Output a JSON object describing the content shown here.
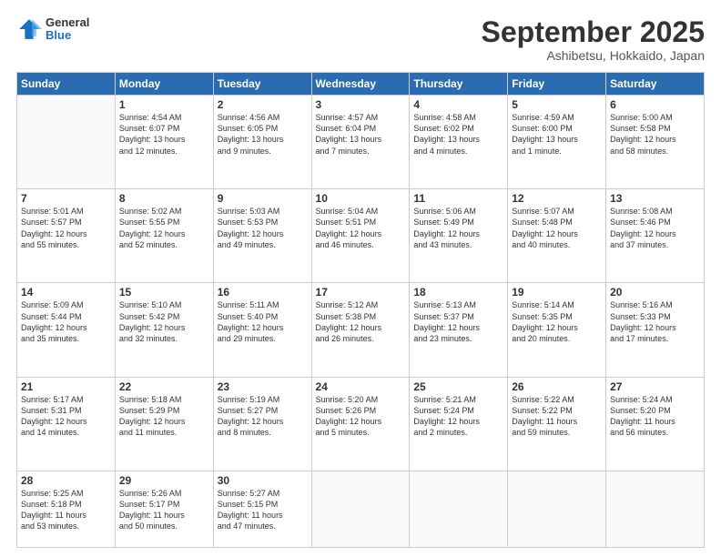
{
  "logo": {
    "general": "General",
    "blue": "Blue"
  },
  "title": "September 2025",
  "subtitle": "Ashibetsu, Hokkaido, Japan",
  "days_of_week": [
    "Sunday",
    "Monday",
    "Tuesday",
    "Wednesday",
    "Thursday",
    "Friday",
    "Saturday"
  ],
  "weeks": [
    [
      {
        "day": "",
        "info": ""
      },
      {
        "day": "1",
        "info": "Sunrise: 4:54 AM\nSunset: 6:07 PM\nDaylight: 13 hours\nand 12 minutes."
      },
      {
        "day": "2",
        "info": "Sunrise: 4:56 AM\nSunset: 6:05 PM\nDaylight: 13 hours\nand 9 minutes."
      },
      {
        "day": "3",
        "info": "Sunrise: 4:57 AM\nSunset: 6:04 PM\nDaylight: 13 hours\nand 7 minutes."
      },
      {
        "day": "4",
        "info": "Sunrise: 4:58 AM\nSunset: 6:02 PM\nDaylight: 13 hours\nand 4 minutes."
      },
      {
        "day": "5",
        "info": "Sunrise: 4:59 AM\nSunset: 6:00 PM\nDaylight: 13 hours\nand 1 minute."
      },
      {
        "day": "6",
        "info": "Sunrise: 5:00 AM\nSunset: 5:58 PM\nDaylight: 12 hours\nand 58 minutes."
      }
    ],
    [
      {
        "day": "7",
        "info": "Sunrise: 5:01 AM\nSunset: 5:57 PM\nDaylight: 12 hours\nand 55 minutes."
      },
      {
        "day": "8",
        "info": "Sunrise: 5:02 AM\nSunset: 5:55 PM\nDaylight: 12 hours\nand 52 minutes."
      },
      {
        "day": "9",
        "info": "Sunrise: 5:03 AM\nSunset: 5:53 PM\nDaylight: 12 hours\nand 49 minutes."
      },
      {
        "day": "10",
        "info": "Sunrise: 5:04 AM\nSunset: 5:51 PM\nDaylight: 12 hours\nand 46 minutes."
      },
      {
        "day": "11",
        "info": "Sunrise: 5:06 AM\nSunset: 5:49 PM\nDaylight: 12 hours\nand 43 minutes."
      },
      {
        "day": "12",
        "info": "Sunrise: 5:07 AM\nSunset: 5:48 PM\nDaylight: 12 hours\nand 40 minutes."
      },
      {
        "day": "13",
        "info": "Sunrise: 5:08 AM\nSunset: 5:46 PM\nDaylight: 12 hours\nand 37 minutes."
      }
    ],
    [
      {
        "day": "14",
        "info": "Sunrise: 5:09 AM\nSunset: 5:44 PM\nDaylight: 12 hours\nand 35 minutes."
      },
      {
        "day": "15",
        "info": "Sunrise: 5:10 AM\nSunset: 5:42 PM\nDaylight: 12 hours\nand 32 minutes."
      },
      {
        "day": "16",
        "info": "Sunrise: 5:11 AM\nSunset: 5:40 PM\nDaylight: 12 hours\nand 29 minutes."
      },
      {
        "day": "17",
        "info": "Sunrise: 5:12 AM\nSunset: 5:38 PM\nDaylight: 12 hours\nand 26 minutes."
      },
      {
        "day": "18",
        "info": "Sunrise: 5:13 AM\nSunset: 5:37 PM\nDaylight: 12 hours\nand 23 minutes."
      },
      {
        "day": "19",
        "info": "Sunrise: 5:14 AM\nSunset: 5:35 PM\nDaylight: 12 hours\nand 20 minutes."
      },
      {
        "day": "20",
        "info": "Sunrise: 5:16 AM\nSunset: 5:33 PM\nDaylight: 12 hours\nand 17 minutes."
      }
    ],
    [
      {
        "day": "21",
        "info": "Sunrise: 5:17 AM\nSunset: 5:31 PM\nDaylight: 12 hours\nand 14 minutes."
      },
      {
        "day": "22",
        "info": "Sunrise: 5:18 AM\nSunset: 5:29 PM\nDaylight: 12 hours\nand 11 minutes."
      },
      {
        "day": "23",
        "info": "Sunrise: 5:19 AM\nSunset: 5:27 PM\nDaylight: 12 hours\nand 8 minutes."
      },
      {
        "day": "24",
        "info": "Sunrise: 5:20 AM\nSunset: 5:26 PM\nDaylight: 12 hours\nand 5 minutes."
      },
      {
        "day": "25",
        "info": "Sunrise: 5:21 AM\nSunset: 5:24 PM\nDaylight: 12 hours\nand 2 minutes."
      },
      {
        "day": "26",
        "info": "Sunrise: 5:22 AM\nSunset: 5:22 PM\nDaylight: 11 hours\nand 59 minutes."
      },
      {
        "day": "27",
        "info": "Sunrise: 5:24 AM\nSunset: 5:20 PM\nDaylight: 11 hours\nand 56 minutes."
      }
    ],
    [
      {
        "day": "28",
        "info": "Sunrise: 5:25 AM\nSunset: 5:18 PM\nDaylight: 11 hours\nand 53 minutes."
      },
      {
        "day": "29",
        "info": "Sunrise: 5:26 AM\nSunset: 5:17 PM\nDaylight: 11 hours\nand 50 minutes."
      },
      {
        "day": "30",
        "info": "Sunrise: 5:27 AM\nSunset: 5:15 PM\nDaylight: 11 hours\nand 47 minutes."
      },
      {
        "day": "",
        "info": ""
      },
      {
        "day": "",
        "info": ""
      },
      {
        "day": "",
        "info": ""
      },
      {
        "day": "",
        "info": ""
      }
    ]
  ]
}
